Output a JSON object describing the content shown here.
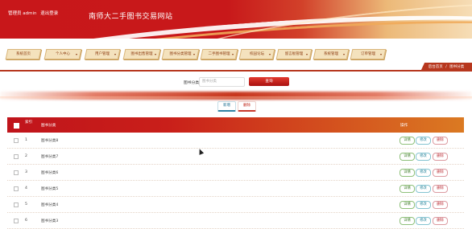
{
  "header": {
    "user_label": "管理员 admin",
    "logout": "退出登录",
    "site_title": "南师大二手图书交易网站"
  },
  "nav": [
    {
      "label": "系统首页",
      "arrow": ""
    },
    {
      "label": "个人中心",
      "arrow": "▾"
    },
    {
      "label": "用户管理",
      "arrow": "▾"
    },
    {
      "label": "图书出售管理",
      "arrow": "▾"
    },
    {
      "label": "图书分类管理",
      "arrow": "▾"
    },
    {
      "label": "二手图书管理",
      "arrow": "▾"
    },
    {
      "label": "校园论坛",
      "arrow": "▾"
    },
    {
      "label": "留言板管理",
      "arrow": "▾"
    },
    {
      "label": "系统管理",
      "arrow": "▾"
    },
    {
      "label": "订单管理",
      "arrow": "▾"
    }
  ],
  "breadcrumb": {
    "home": "后台首页",
    "sep": "/",
    "current": "图书分类"
  },
  "search": {
    "label": "图书分类",
    "placeholder": "图书分类",
    "button": "查询"
  },
  "actions": {
    "add": "新增",
    "delete": "删除"
  },
  "table": {
    "columns": {
      "index": "索引",
      "name": "图书分类",
      "ops": "操作"
    },
    "rows": [
      {
        "index": "1",
        "name": "图书分类8"
      },
      {
        "index": "2",
        "name": "图书分类7"
      },
      {
        "index": "3",
        "name": "图书分类6"
      },
      {
        "index": "4",
        "name": "图书分类5"
      },
      {
        "index": "5",
        "name": "图书分类4"
      },
      {
        "index": "6",
        "name": "图书分类3"
      }
    ],
    "row_buttons": {
      "detail": "详情",
      "edit": "修改",
      "delete": "删除"
    }
  },
  "colors": {
    "primary_red": "#c0141b",
    "accent_orange": "#db7a22"
  }
}
